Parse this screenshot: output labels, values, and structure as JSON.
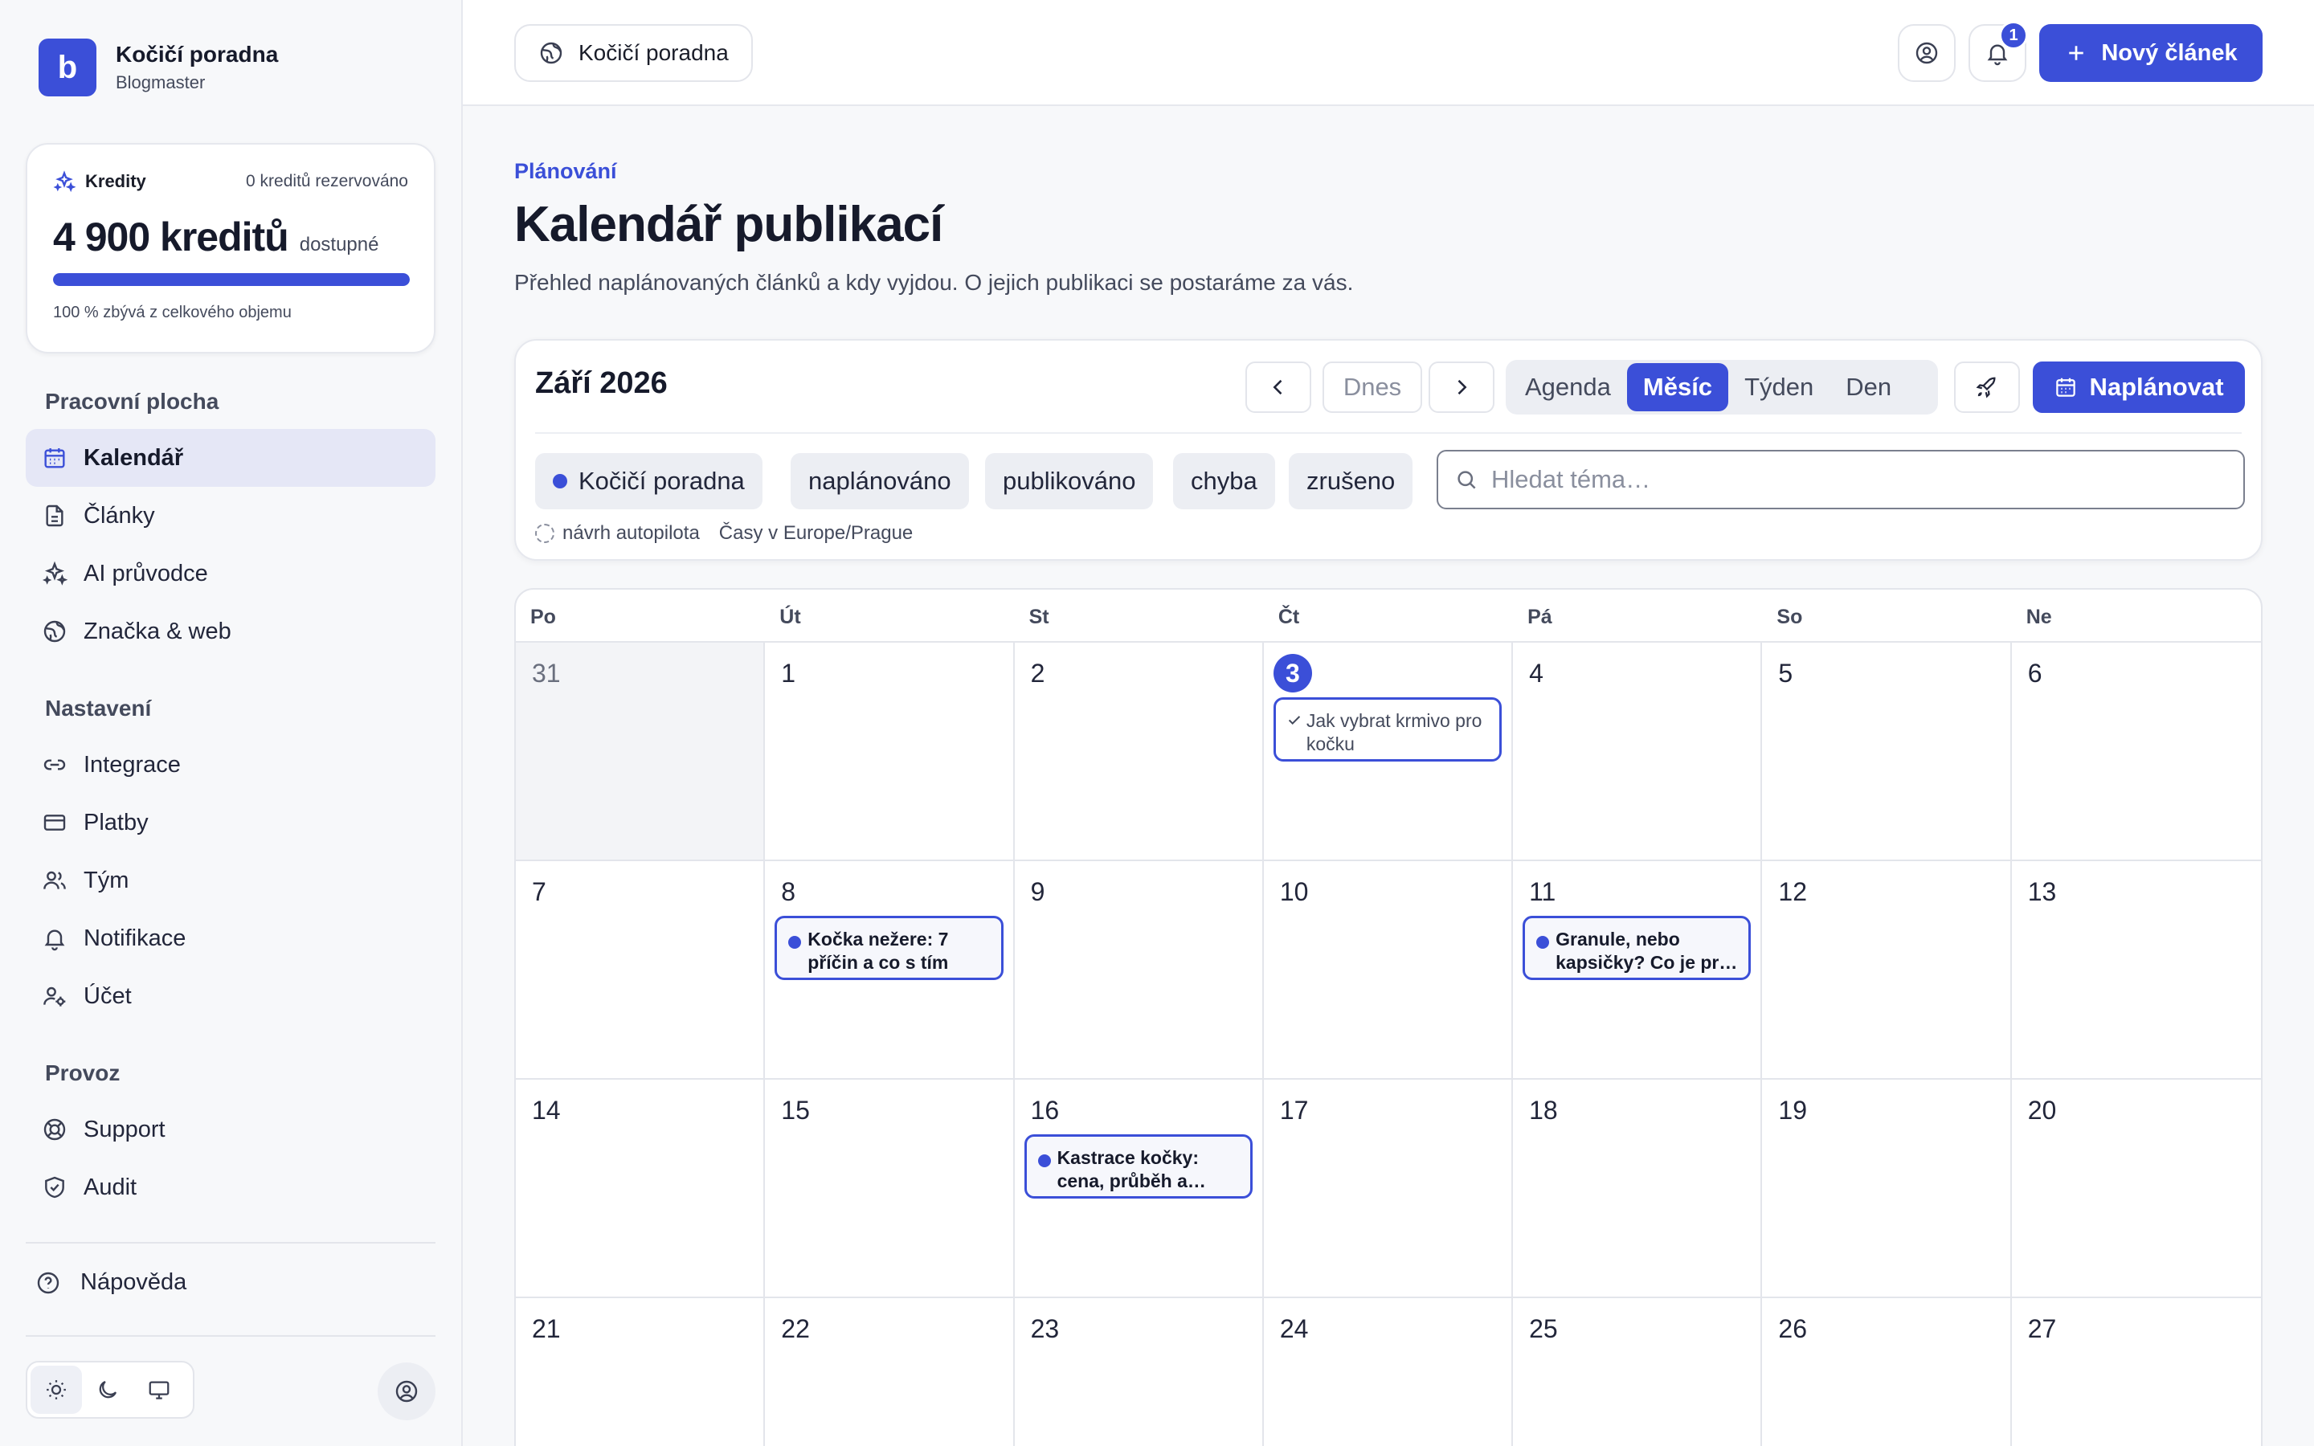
{
  "brand": {
    "logo_letter": "b",
    "name": "Kočičí poradna",
    "subtitle": "Blogmaster"
  },
  "credits": {
    "label": "Kredity",
    "reserved": "0 kreditů rezervováno",
    "amount": "4 900 kreditů",
    "available_label": "dostupné",
    "remaining_fraction": 1.0,
    "note": "100 % zbývá z celkového objemu"
  },
  "sidebar": {
    "sections": [
      {
        "title": "Pracovní plocha"
      },
      {
        "title": "Nastavení"
      },
      {
        "title": "Provoz"
      }
    ],
    "items": [
      {
        "label": "Kalendář",
        "icon": "calendar-icon",
        "active": true
      },
      {
        "label": "Články",
        "icon": "document-icon"
      },
      {
        "label": "AI průvodce",
        "icon": "sparkles-icon"
      },
      {
        "label": "Značka & web",
        "icon": "globe-icon"
      },
      {
        "label": "Integrace",
        "icon": "link-icon"
      },
      {
        "label": "Platby",
        "icon": "credit-card-icon"
      },
      {
        "label": "Tým",
        "icon": "users-icon"
      },
      {
        "label": "Notifikace",
        "icon": "bell-icon"
      },
      {
        "label": "Účet",
        "icon": "user-settings-icon"
      },
      {
        "label": "Support",
        "icon": "lifebuoy-icon"
      },
      {
        "label": "Audit",
        "icon": "shield-icon"
      }
    ],
    "help": {
      "label": "Nápověda",
      "icon": "question-circle-icon"
    },
    "theme": {
      "options": [
        "light",
        "dark",
        "system"
      ],
      "selected": "light"
    }
  },
  "topbar": {
    "blog_selector": "Kočičí poradna",
    "notification_count": "1",
    "new_article": "Nový článek"
  },
  "header": {
    "eyebrow": "Plánování",
    "title": "Kalendář publikací",
    "description": "Přehled naplánovaných článků a kdy vyjdou. O jejich publikaci se postaráme za vás."
  },
  "toolbar": {
    "month": "Září 2026",
    "today": "Dnes",
    "views": [
      "Agenda",
      "Měsíc",
      "Týden",
      "Den"
    ],
    "active_view": "Měsíc",
    "schedule": "Naplánovat",
    "filters": [
      "Kočičí poradna",
      "naplánováno",
      "publikováno",
      "chyba",
      "zrušeno"
    ],
    "search_placeholder": "Hledat téma…",
    "legend_autopilot": "návrh autopilota",
    "timezone": "Časy v Europe/Prague"
  },
  "calendar": {
    "weekdays": [
      "Po",
      "Út",
      "St",
      "Čt",
      "Pá",
      "So",
      "Ne"
    ],
    "weeks": [
      [
        "31",
        "1",
        "2",
        "3",
        "4",
        "5",
        "6"
      ],
      [
        "7",
        "8",
        "9",
        "10",
        "11",
        "12",
        "13"
      ],
      [
        "14",
        "15",
        "16",
        "17",
        "18",
        "19",
        "20"
      ],
      [
        "21",
        "22",
        "23",
        "24",
        "25",
        "26",
        "27"
      ]
    ],
    "today": "3",
    "events": [
      {
        "day": "3",
        "title": "Jak vybrat krmivo pro kočku",
        "status": "publikováno"
      },
      {
        "day": "8",
        "title": "Kočka nežere: 7 příčin a co s tím",
        "status": "naplánováno"
      },
      {
        "day": "11",
        "title": "Granule, nebo kapsičky? Co je pr…",
        "status": "naplánováno"
      },
      {
        "day": "16",
        "title": "Kastrace kočky: cena, průběh a…",
        "status": "naplánováno"
      }
    ]
  },
  "colors": {
    "accent": "#3b4fd8",
    "sidebar_active_bg": "#e5e7f6",
    "page_bg": "#f7f8fa"
  }
}
